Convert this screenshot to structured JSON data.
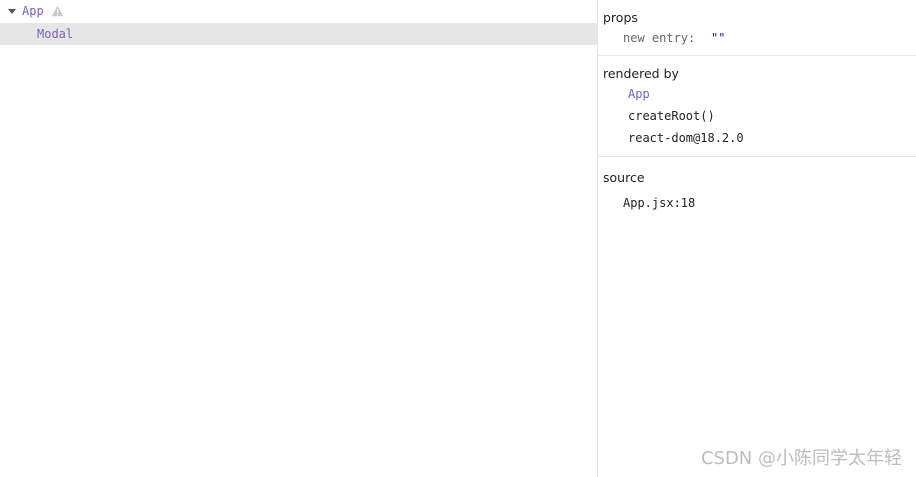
{
  "tree": {
    "items": [
      {
        "label": "App",
        "expanded": true,
        "has_warning": true
      },
      {
        "label": "Modal",
        "selected": true
      }
    ]
  },
  "inspector": {
    "props": {
      "title": "props",
      "entries": [
        {
          "key": "new entry:",
          "value": "\"\""
        }
      ]
    },
    "rendered_by": {
      "title": "rendered by",
      "items": [
        "App",
        "createRoot()",
        "react-dom@18.2.0"
      ]
    },
    "source": {
      "title": "source",
      "location": "App.jsx:18"
    }
  },
  "watermark": "CSDN @小陈同学太年轻",
  "colors": {
    "component_name": "#7e5dc0",
    "selected_row_bg": "#e6e6e6",
    "prop_value": "#1a1aa6",
    "warning_icon": "#bdbdbd"
  }
}
